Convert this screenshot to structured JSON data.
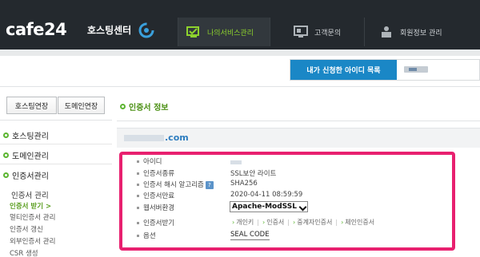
{
  "header": {
    "logo": "cafe24",
    "logo_sub": "호스팅센터",
    "nav": [
      {
        "label": "나의서비스관리",
        "icon": "service-management-icon",
        "active": true
      },
      {
        "label": "고객문의",
        "icon": "customer-inquiry-icon",
        "active": false
      },
      {
        "label": "회원정보 관리",
        "icon": "member-info-icon",
        "active": false
      }
    ]
  },
  "id_bar": {
    "label": "내가 신청한 아이디 목록"
  },
  "sidebar": {
    "buttons": [
      "호스팅연장",
      "도메인연장"
    ],
    "sections": [
      "호스팅관리",
      "도메인관리",
      "인증서관리"
    ],
    "sub_title": "인증서 관리",
    "sub_items": [
      "인증서 받기 >",
      "멀티인증서 관리",
      "인증서 갱신",
      "외부인증서 관리",
      "CSR 생성"
    ]
  },
  "main": {
    "section_title": "인증서 정보",
    "domain": ".com",
    "rows": [
      {
        "label": "아이디",
        "value": ""
      },
      {
        "label": "인증서종류",
        "value": "SSL보안 라이트"
      },
      {
        "label": "인증서 해시 알고리즘",
        "value": "SHA256"
      },
      {
        "label": "인증서만료",
        "value": "2020-04-11 08:59:59"
      },
      {
        "label": "웹서버환경",
        "value": "Apache-ModSSL"
      },
      {
        "label": "인증서받기",
        "value": ""
      },
      {
        "label": "옵션",
        "value": "SEAL CODE"
      }
    ],
    "help_label": "?",
    "cert_links": [
      "개인키",
      "인증서",
      "중계자인증서",
      "체인인증서"
    ]
  },
  "colors": {
    "accent_green": "#5cb531",
    "accent_blue": "#1a87c6",
    "highlight_pink": "#e8206f"
  }
}
